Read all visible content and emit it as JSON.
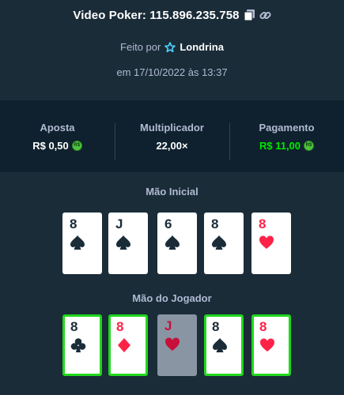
{
  "header": {
    "title": "Video Poker: 115.896.235.758",
    "copy_icon": "copy-icon",
    "link_icon": "link-icon"
  },
  "meta": {
    "by_label": "Feito por",
    "username": "Londrina",
    "user_icon": "star-badge-icon",
    "date": "em 17/10/2022 às 13:37"
  },
  "stats": {
    "bet_label": "Aposta",
    "bet_value": "R$ 0,50",
    "multiplier_label": "Multiplicador",
    "multiplier_value": "22,00×",
    "payout_label": "Pagamento",
    "payout_value": "R$ 11,00",
    "currency_icon_text": "R$"
  },
  "initial_hand": {
    "title": "Mão Inicial",
    "cards": [
      {
        "rank": "8",
        "suit": "spade"
      },
      {
        "rank": "J",
        "suit": "spade"
      },
      {
        "rank": "6",
        "suit": "spade"
      },
      {
        "rank": "8",
        "suit": "spade"
      },
      {
        "rank": "8",
        "suit": "heart"
      }
    ]
  },
  "player_hand": {
    "title": "Mão do Jogador",
    "cards": [
      {
        "rank": "8",
        "suit": "club",
        "held": true
      },
      {
        "rank": "8",
        "suit": "diamond",
        "held": true
      },
      {
        "rank": "J",
        "suit": "heart",
        "held": false,
        "discarded": true
      },
      {
        "rank": "8",
        "suit": "spade",
        "held": true
      },
      {
        "rank": "8",
        "suit": "heart",
        "held": true
      }
    ]
  },
  "colors": {
    "background": "#1a2c38",
    "panel": "#0f212e",
    "held_border": "#1fd81c",
    "payout_green": "#00e701",
    "red_suit": "#fe2247"
  }
}
